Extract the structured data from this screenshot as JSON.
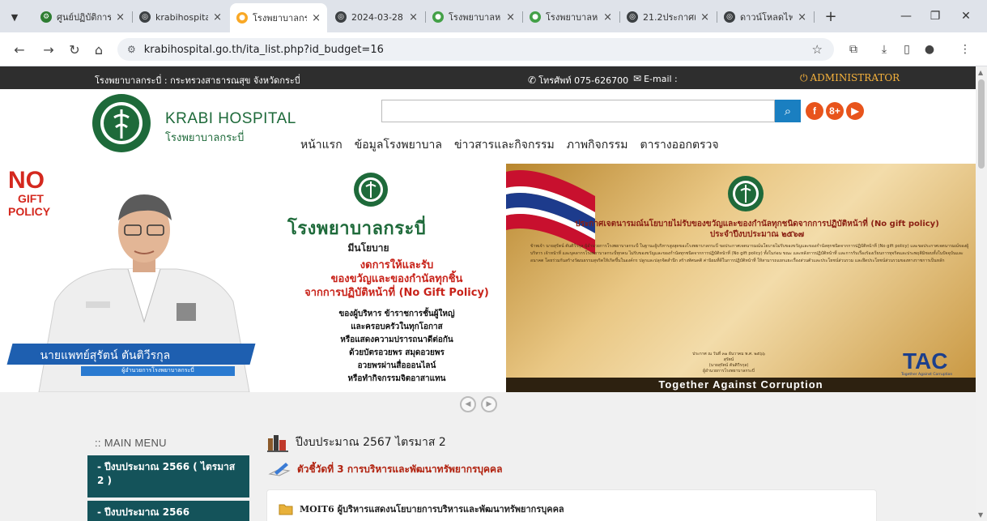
{
  "browser": {
    "tabs": [
      {
        "title": "ศูนย์ปฏิบัติการ",
        "fav_color": "#2e7d32",
        "fav_glyph": "⚙"
      },
      {
        "title": "krabihospita",
        "fav_color": "#3c4043",
        "fav_glyph": "◎"
      },
      {
        "title": "โรงพยาบาลกร",
        "fav_color": "#f9a825",
        "fav_glyph": "●"
      },
      {
        "title": "2024-03-28",
        "fav_color": "#3c4043",
        "fav_glyph": "◎"
      },
      {
        "title": "โรงพยาบาลห",
        "fav_color": "#43a047",
        "fav_glyph": "●"
      },
      {
        "title": "โรงพยาบาลห",
        "fav_color": "#43a047",
        "fav_glyph": "●"
      },
      {
        "title": "21.2ประกาศเ",
        "fav_color": "#3c4043",
        "fav_glyph": "◎"
      },
      {
        "title": "ดาวน์โหลดไฟล",
        "fav_color": "#3c4043",
        "fav_glyph": "◎"
      }
    ],
    "url": "krabihospital.go.th/ita_list.php?id_budget=16",
    "accent": "#dfe3ea"
  },
  "topstrip": {
    "org": "โรงพยาบาลกระบี่ : กระทรวงสาธารณสุข จังหวัดกระบี่",
    "phone": "โทรศัพท์ 075-626700",
    "email": "E-mail :",
    "admin": "ADMINISTRATOR"
  },
  "header": {
    "brand_en": "KRABI HOSPITAL",
    "brand_th": "โรงพยาบาลกระบี่",
    "search_placeholder": "",
    "nav": [
      "หน้าแรก",
      "ข้อมูลโรงพยาบาล",
      "ข่าวสารและกิจกรรม",
      "ภาพกิจกรรม",
      "ตารางออกตรวจ"
    ],
    "social": [
      {
        "name": "facebook-icon",
        "glyph": "f",
        "color": "#e8541c"
      },
      {
        "name": "googleplus-icon",
        "glyph": "8+",
        "color": "#e8541c"
      },
      {
        "name": "youtube-icon",
        "glyph": "▶",
        "color": "#e8541c"
      }
    ]
  },
  "banner": {
    "nogift_no": "NO",
    "nogift_gift": "GIFT",
    "nogift_policy": "POLICY",
    "doctor_name": "นายแพทย์สุรัตน์ ตันติวีรกุล",
    "doctor_title": "ผู้อำนวยการโรงพยาบาลกระบี่",
    "hospital": "โรงพยาบาลกระบี่",
    "has_policy": "มีนโยบาย",
    "red_text": [
      "งดการให้และรับ",
      "ของขวัญและของกำนัลทุกชิ้น",
      "จากการปฏิบัติหน้าที่ (No Gift Policy)"
    ],
    "body_text": [
      "ของผู้บริหาร ข้าราชการชั้นผู้ใหญ่",
      "และครอบครัวในทุกโอกาส",
      "หรือแสดงความปรารถนาดีต่อกัน",
      "ด้วยบัตรอวยพร สมุดอวยพร",
      "อวยพรผ่านสื่อออนไลน์",
      "หรือทำกิจกรรมจิตอาสาแทน"
    ],
    "ann_title": [
      "ประกาศเจตนารมณ์นโยบายไม่รับของขวัญและของกำนัลทุกชนิดจากการปฏิบัติหน้าที่ (No gift policy)",
      "ประจำปีงบประมาณ ๒๕๖๗"
    ],
    "ann_body": "ข้าพเจ้า นายสุรัตน์ ตันติวีรกุล ผู้อำนวยการโรงพยาบาลกระบี่ ในฐานะผู้บริหารสูงสุดของโรงพยาบาลกระบี่ ขอประกาศเจตนารมณ์นโยบายไม่รับของขวัญและของกำนัลทุกชนิดจากการปฏิบัติหน้าที่ (No gift policy) และขอประกาศเจตนารมณ์ของผู้บริหาร เจ้าหน้าที่ และบุคลากรโรงพยาบาลกระบี่ทุกคน ไม่รับของขวัญและของกำนัลทุกชนิดจากการปฏิบัติหน้าที่ (No gift policy) ทั้งในก่อน ขณะ และหลังการปฏิบัติหน้าที่ และการรับเรื่องร้องเรียนการทุจริตและประพฤติมิชอบทั้งในปัจจุบันและอนาคต โดยร่วมกันสร้างวัฒนธรรมสุจริตให้เกิดขึ้นในองค์กร ปลูกและปลุกจิตสำนึก สร้างทัศนคติ ค่านิยมที่ดีในการปฏิบัติหน้าที่ ให้สามารถแยกแยะเรื่องส่วนตัวและประโยชน์ส่วนรวม และยึดประโยชน์ส่วนรวมของทางราชการเป็นหลัก",
    "ann_sign": [
      "ประกาศ ณ วันที่ ๓๑ ธันวาคม พ.ศ. ๒๕๖๖",
      "สุรัตน์",
      "(นายสุรัตน์ ตันติวีรกุล)",
      "ผู้อำนวยการโรงพยาบาลกระบี่"
    ],
    "tac": "TAC",
    "tac_small": "Together Against Corruption",
    "ann_footer": "Together Against Corruption"
  },
  "main_menu": {
    "title": ":: MAIN MENU",
    "items": [
      "- ปีงบประมาณ 2566 ( ไตรมาส 2 )",
      "- ปีงบประมาณ 2566"
    ]
  },
  "content": {
    "budget_title": "ปีงบประมาณ 2567 ไตรมาส 2",
    "kpi_title": "ตัวชี้วัดที่ 3 การบริหารและพัฒนาทรัพยากรบุคคล",
    "moit_title": "MOIT6 ผู้บริหารแสดงนโยบายการบริหารและพัฒนาทรัพยากรบุคคล"
  }
}
